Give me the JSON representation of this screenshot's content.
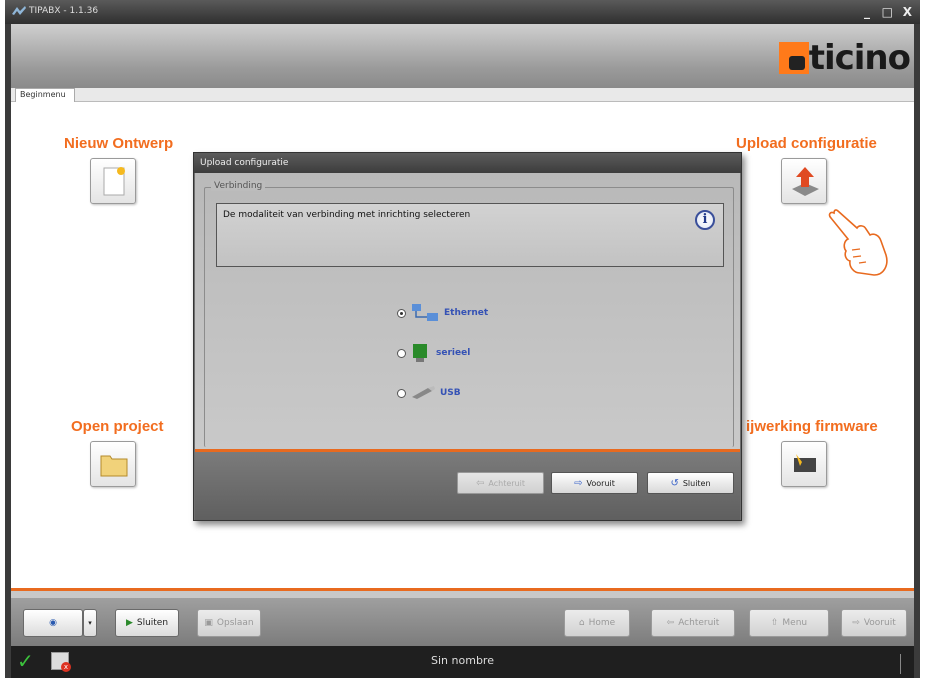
{
  "window": {
    "title": "TIPABX - 1.1.36",
    "controls": [
      "_",
      "□",
      "X"
    ]
  },
  "header": {
    "logo_text": "ticino",
    "logo_accent": "#ff7a1a"
  },
  "tabs": [
    {
      "label": "Beginmenu"
    }
  ],
  "tiles": {
    "new_project": {
      "label": "Nieuw Ontwerp",
      "icon": "new-document-icon"
    },
    "upload_config": {
      "label": "Upload configuratie",
      "icon": "upload-icon"
    },
    "open_project": {
      "label": "Open project",
      "icon": "folder-icon"
    },
    "firmware": {
      "label": "ijwerking firmware",
      "icon": "chip-icon"
    }
  },
  "dialog": {
    "title": "Upload configuratie",
    "group_label": "Verbinding",
    "message": "De modaliteit van verbinding met inrichting selecteren",
    "options": [
      {
        "label": "Ethernet",
        "icon": "network-icon",
        "checked": true
      },
      {
        "label": "serieel",
        "icon": "serial-icon",
        "checked": false
      },
      {
        "label": "USB",
        "icon": "usb-icon",
        "checked": false
      }
    ],
    "buttons": {
      "back": "Achteruit",
      "next": "Vooruit",
      "close": "Sluiten"
    }
  },
  "toolbar": {
    "close_label": "Sluiten",
    "save_label": "Opslaan",
    "home_label": "Home",
    "back_label": "Achteruit",
    "menu_label": "Menu",
    "next_label": "Vooruit"
  },
  "status": {
    "text": "Sin nombre"
  },
  "colors": {
    "accent": "#e86a1f",
    "title_orange": "#f26d1f",
    "link_blue": "#3552b5"
  }
}
